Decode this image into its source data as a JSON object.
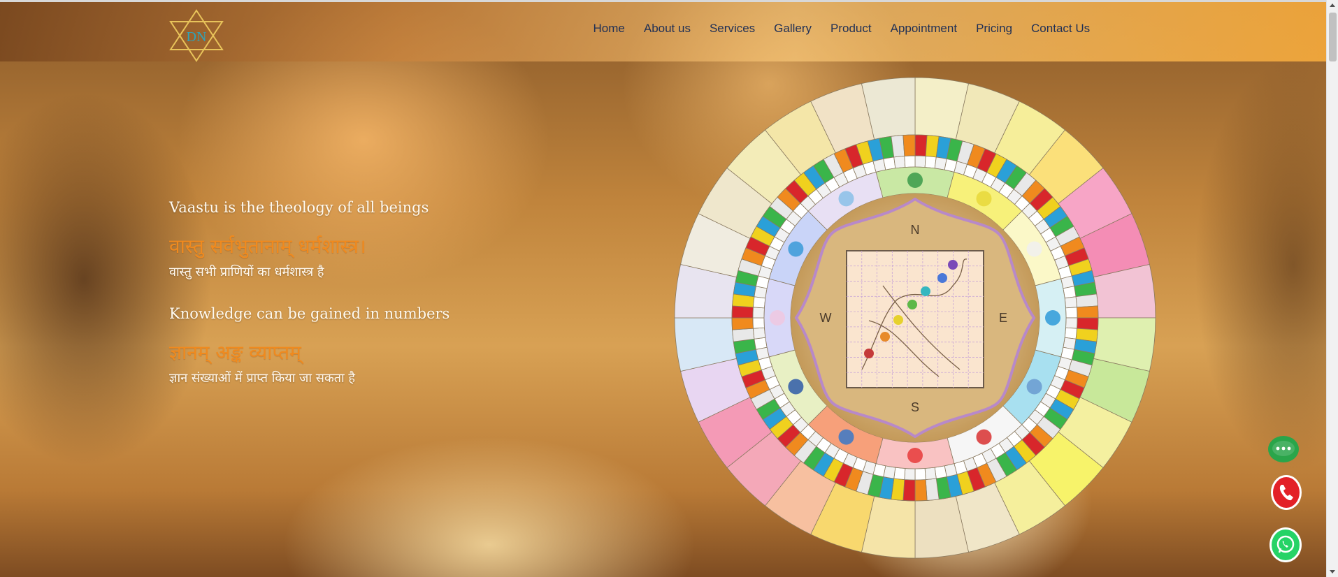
{
  "logo": {
    "text": "DN"
  },
  "nav": {
    "items": [
      {
        "label": "Home"
      },
      {
        "label": "About us"
      },
      {
        "label": "Services"
      },
      {
        "label": "Gallery"
      },
      {
        "label": "Product"
      },
      {
        "label": "Appointment"
      },
      {
        "label": "Pricing"
      },
      {
        "label": "Contact Us"
      }
    ]
  },
  "hero": {
    "line1_en": "Vaastu is the theology of all beings",
    "line1_sa": "वास्तु सर्वभुतानाम् धर्मशास्त्र।",
    "line1_hi": "वास्तु सभी प्राणियों का धर्मशास्त्र है",
    "line2_en": "Knowledge can be gained in numbers",
    "line2_sa": "ज्ञानम् अङ्क व्याप्तम्",
    "line2_hi": "ज्ञान संख्याओं में प्राप्त किया जा सकता है"
  },
  "wheel": {
    "directions": {
      "n": "N",
      "s": "S",
      "e": "E",
      "w": "W"
    }
  },
  "colors": {
    "nav_text": "#1f2f55",
    "sanskrit": "#f08a1e",
    "chat": "#2aa54a",
    "phone": "#e32027",
    "whatsapp": "#25d366"
  }
}
